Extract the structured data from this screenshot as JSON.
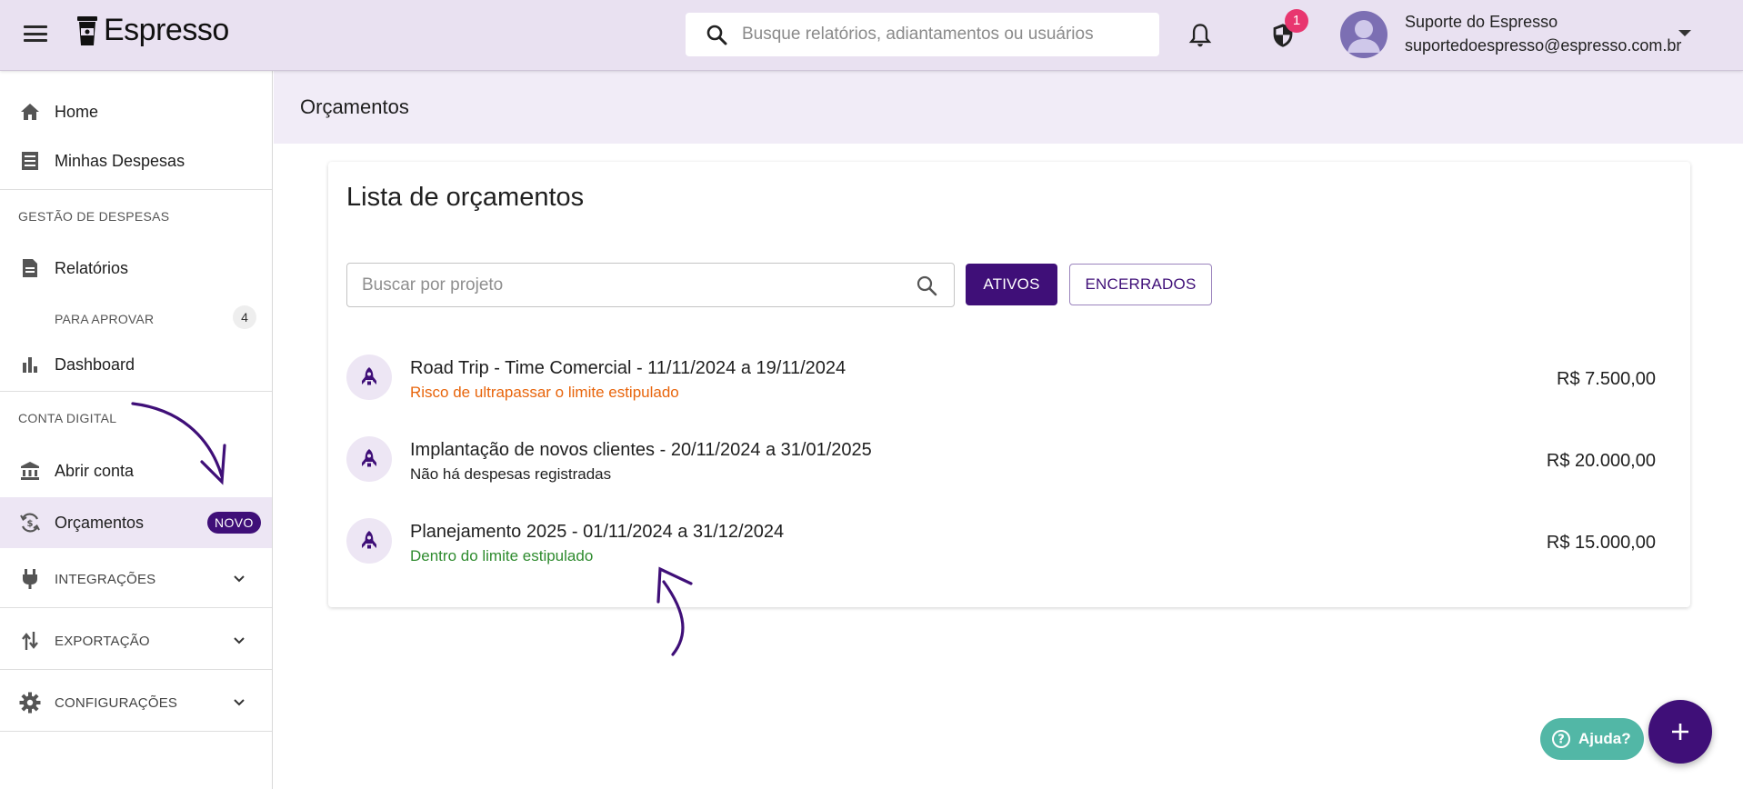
{
  "app": {
    "name": "Espresso"
  },
  "topbar": {
    "search_placeholder": "Busque relatórios, adiantamentos ou usuários",
    "security_badge": "1",
    "user_name": "Suporte do Espresso",
    "user_email": "suportedoespresso@espresso.com.br"
  },
  "sidebar": {
    "home": "Home",
    "minhas_despesas": "Minhas Despesas",
    "section_gestao": "GESTÃO DE DESPESAS",
    "relatorios": "Relatórios",
    "para_aprovar": "PARA APROVAR",
    "para_aprovar_count": "4",
    "dashboard": "Dashboard",
    "section_conta": "CONTA DIGITAL",
    "abrir_conta": "Abrir conta",
    "orcamentos": "Orçamentos",
    "orcamentos_badge": "NOVO",
    "integracoes": "INTEGRAÇÕES",
    "exportacao": "EXPORTAÇÃO",
    "configuracoes": "CONFIGURAÇÕES"
  },
  "main": {
    "page_title": "Orçamentos",
    "card_title": "Lista de orçamentos",
    "search_placeholder": "Buscar por projeto",
    "btn_ativos": "ATIVOS",
    "btn_encerrados": "ENCERRADOS",
    "budgets": [
      {
        "title": "Road Trip - Time Comercial - 11/11/2024 a 19/11/2024",
        "status": "Risco de ultrapassar o limite estipulado",
        "status_color": "#e8650c",
        "amount": "R$ 7.500,00"
      },
      {
        "title": "Implantação de novos clientes - 20/11/2024 a 31/01/2025",
        "status": "Não há despesas registradas",
        "status_color": "#1f1f1f",
        "amount": "R$ 20.000,00"
      },
      {
        "title": "Planejamento 2025 - 01/11/2024 a 31/12/2024",
        "status": "Dentro do limite estipulado",
        "status_color": "#2e8b2e",
        "amount": "R$ 15.000,00"
      }
    ]
  },
  "help": {
    "label": "Ajuda?"
  },
  "colors": {
    "brand": "#3f0f78",
    "topbar_bg": "#e9e1f1",
    "help": "#52b7a6"
  }
}
